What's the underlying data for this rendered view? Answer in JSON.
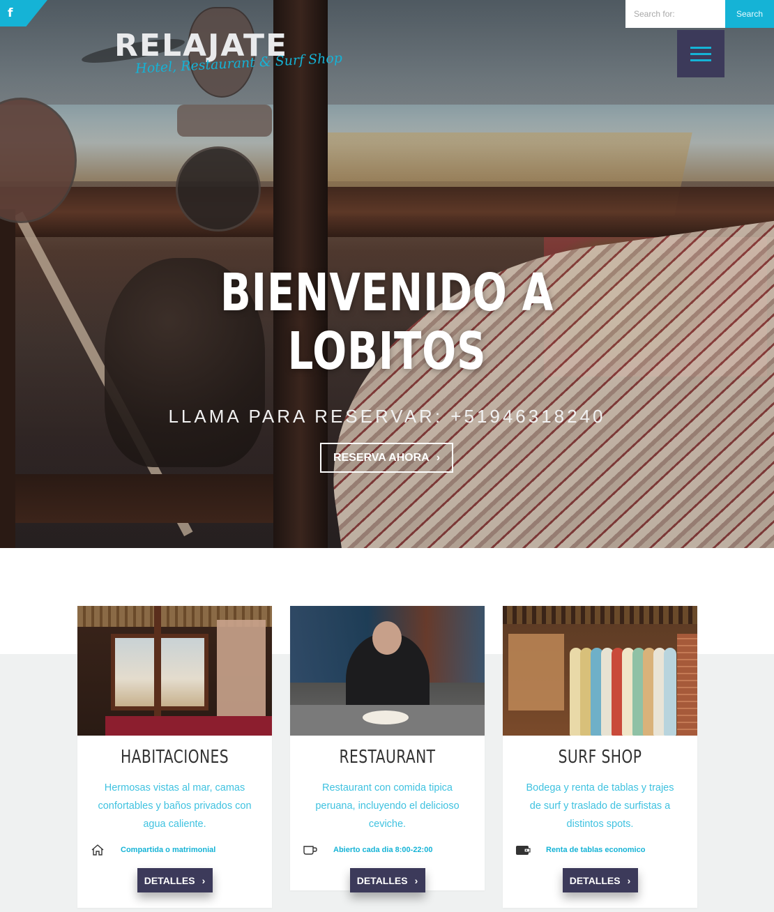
{
  "social": {
    "facebook_icon": "f"
  },
  "logo": {
    "title": "RELAJATE",
    "tagline": "Hotel, Restaurant & Surf Shop"
  },
  "search": {
    "placeholder": "Search for:",
    "button_label": "Search"
  },
  "menu": {
    "icon": "hamburger-menu-icon"
  },
  "hero": {
    "title_line1": "BIENVENIDO A",
    "title_line2": "LOBITOS",
    "subtitle": "LLAMA PARA RESERVAR: +51946318240",
    "cta_label": "RESERVA AHORA",
    "cta_arrow": "›"
  },
  "cards": [
    {
      "title": "HABITACIONES",
      "description": "Hermosas vistas al mar, camas confortables y baños privados con agua caliente.",
      "feature_icon": "home-icon",
      "feature_text": "Compartida o matrimonial",
      "button_label": "DETALLES",
      "button_arrow": "›"
    },
    {
      "title": "RESTAURANT",
      "description": "Restaurant con comida tipica peruana, incluyendo el delicioso ceviche.",
      "feature_icon": "cup-icon",
      "feature_text": "Abierto cada dia 8:00-22:00",
      "button_label": "DETALLES",
      "button_arrow": "›"
    },
    {
      "title": "SURF SHOP",
      "description": "Bodega y renta de tablas y trajes de surf y traslado de surfistas a distintos spots.",
      "feature_icon": "wallet-icon",
      "feature_text": "Renta de tablas economico",
      "button_label": "DETALLES",
      "button_arrow": "›"
    }
  ],
  "colors": {
    "accent": "#15b3d6",
    "dark_button": "#3c3a5a",
    "section_bg": "#eff1f1"
  }
}
